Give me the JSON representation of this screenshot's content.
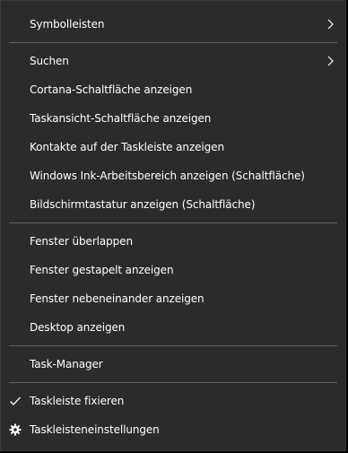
{
  "menu": {
    "group1": {
      "toolbars": "Symbolleisten"
    },
    "group2": {
      "search": "Suchen",
      "cortana": "Cortana-Schaltfläche anzeigen",
      "taskview": "Taskansicht-Schaltfläche anzeigen",
      "contacts": "Kontakte auf der Taskleiste anzeigen",
      "ink": "Windows Ink-Arbeitsbereich anzeigen (Schaltfläche)",
      "keyboard": "Bildschirmtastatur anzeigen (Schaltfläche)"
    },
    "group3": {
      "cascade": "Fenster überlappen",
      "stacked": "Fenster gestapelt anzeigen",
      "side_by_side": "Fenster nebeneinander anzeigen",
      "desktop": "Desktop anzeigen"
    },
    "group4": {
      "task_manager": "Task-Manager"
    },
    "group5": {
      "lock_taskbar": "Taskleiste fixieren",
      "taskbar_settings": "Taskleisteneinstellungen"
    }
  },
  "icons": {
    "submenu": "chevron-right-icon",
    "checked": "checkmark-icon",
    "settings": "gear-icon"
  },
  "colors": {
    "background": "#2b2b2b",
    "text": "#ffffff",
    "separator": "#616161"
  }
}
